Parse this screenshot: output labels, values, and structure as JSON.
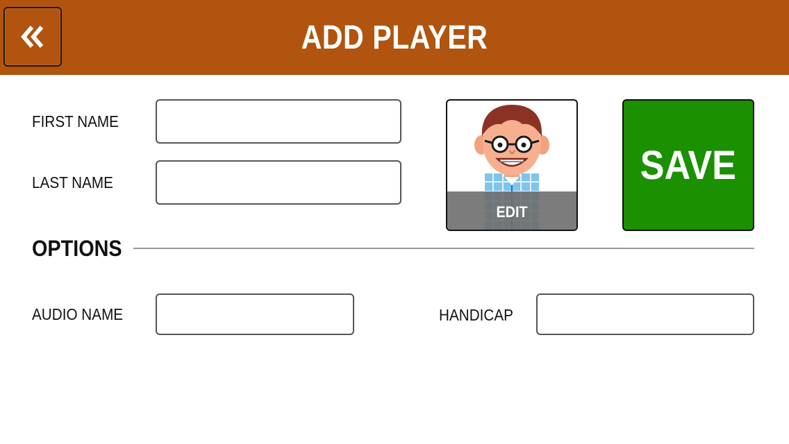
{
  "header": {
    "title": "ADD PLAYER",
    "back_icon": "double-chevron-left-icon",
    "color": "#b0540f"
  },
  "form": {
    "first_name": {
      "label": "FIRST NAME",
      "value": ""
    },
    "last_name": {
      "label": "LAST NAME",
      "value": ""
    },
    "avatar": {
      "edit_label": "EDIT",
      "icon": "cartoon-avatar-icon"
    },
    "save": {
      "label": "SAVE",
      "color": "#1b9000"
    }
  },
  "options": {
    "heading": "OPTIONS",
    "audio_name": {
      "label": "AUDIO NAME",
      "value": ""
    },
    "handicap": {
      "label": "HANDICAP",
      "value": ""
    }
  }
}
